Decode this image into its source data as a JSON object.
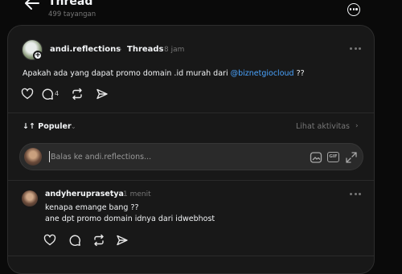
{
  "header": {
    "title": "Thread",
    "views": "499 tayangan"
  },
  "post": {
    "username": "andi.reflections",
    "breadcrumb": "Threads",
    "time": "8 jam",
    "text_before": "Apakah ada yang dapat promo domain .id murah dari ",
    "mention": "@biznetgiocloud",
    "text_after": " ??",
    "reply_count": "4"
  },
  "sort": {
    "label": "Populer",
    "activity_link": "Lihat aktivitas"
  },
  "reply_box": {
    "placeholder": "Balas ke andi.reflections..."
  },
  "comment": {
    "username": "andyheruprasetya",
    "time": "1 menit",
    "line1": "kenapa emange bang ??",
    "line2": "ane dpt promo domain idnya dari idwebhost"
  },
  "icons": {
    "back": "arrow-left-icon",
    "more": "more-horizontal-icon",
    "like": "heart-icon",
    "reply": "comment-icon",
    "repost": "repost-icon",
    "share": "send-icon",
    "image": "image-icon",
    "gif": "gif-icon",
    "expand": "expand-icon"
  },
  "colors": {
    "background": "#0a0a0a",
    "card": "#181818",
    "link": "#4aa4ff",
    "muted": "#777777"
  }
}
